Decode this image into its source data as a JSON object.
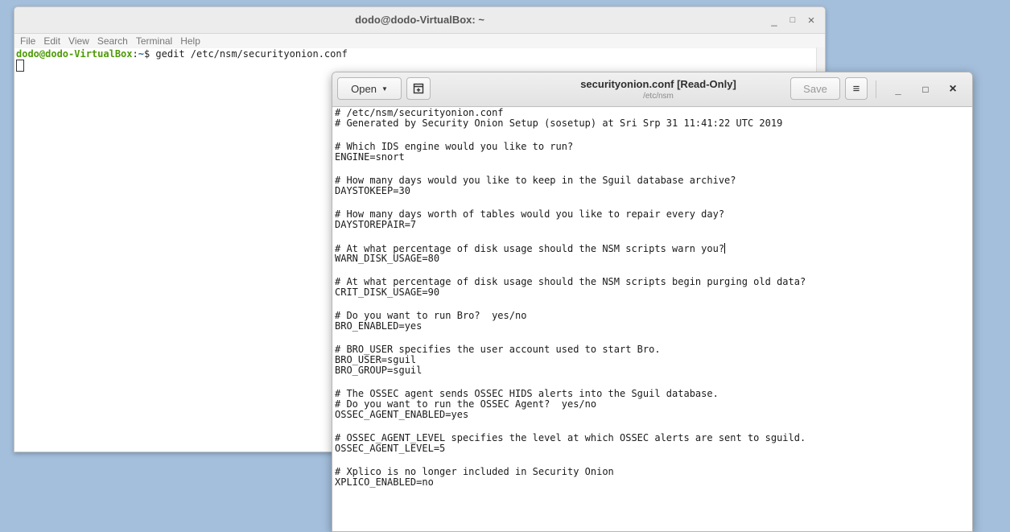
{
  "terminal": {
    "title": "dodo@dodo-VirtualBox: ~",
    "menu": [
      "File",
      "Edit",
      "View",
      "Search",
      "Terminal",
      "Help"
    ],
    "prompt_user": "dodo@dodo-VirtualBox",
    "prompt_sep": ":",
    "prompt_path": "~",
    "prompt_symbol": "$ ",
    "command": "gedit /etc/nsm/securityonion.conf",
    "controls": {
      "minimize": "_",
      "maximize": "□",
      "close": "×"
    }
  },
  "gedit": {
    "open_label": "Open",
    "open_arrow": "▼",
    "title": "securityonion.conf [Read-Only]",
    "subtitle": "/etc/nsm",
    "save_label": "Save",
    "menu_icon": "≡",
    "controls": {
      "minimize": "_",
      "maximize": "□",
      "close": "×"
    },
    "lines": [
      "# /etc/nsm/securityonion.conf",
      "# Generated by Security Onion Setup (sosetup) at Sri Srp 31 11:41:22 UTC 2019",
      "",
      "# Which IDS engine would you like to run?",
      "ENGINE=snort",
      "",
      "# How many days would you like to keep in the Sguil database archive?",
      "DAYSTOKEEP=30",
      "",
      "# How many days worth of tables would you like to repair every day?",
      "DAYSTOREPAIR=7",
      "",
      "# At what percentage of disk usage should the NSM scripts warn you?",
      "WARN_DISK_USAGE=80",
      "",
      "# At what percentage of disk usage should the NSM scripts begin purging old data?",
      "CRIT_DISK_USAGE=90",
      "",
      "# Do you want to run Bro?  yes/no",
      "BRO_ENABLED=yes",
      "",
      "# BRO_USER specifies the user account used to start Bro.",
      "BRO_USER=sguil",
      "BRO_GROUP=sguil",
      "",
      "# The OSSEC agent sends OSSEC HIDS alerts into the Sguil database.",
      "# Do you want to run the OSSEC Agent?  yes/no",
      "OSSEC_AGENT_ENABLED=yes",
      "",
      "# OSSEC_AGENT_LEVEL specifies the level at which OSSEC alerts are sent to sguild.",
      "OSSEC_AGENT_LEVEL=5",
      "",
      "# Xplico is no longer included in Security Onion",
      "XPLICO_ENABLED=no"
    ]
  }
}
